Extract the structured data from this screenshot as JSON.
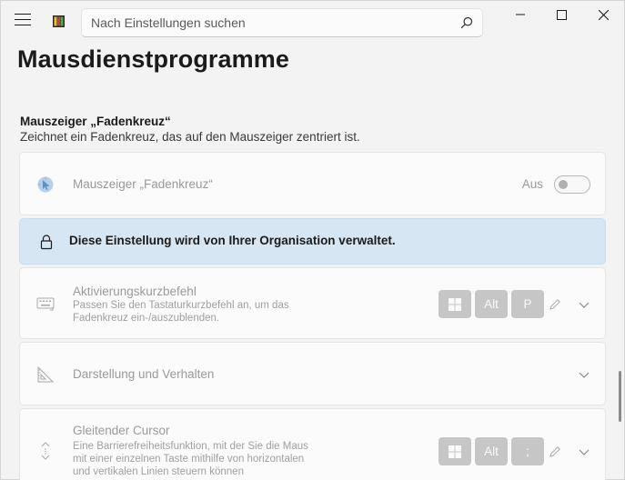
{
  "search": {
    "placeholder": "Nach Einstellungen suchen"
  },
  "page": {
    "title": "Mausdienstprogramme"
  },
  "section": {
    "title": "Mauszeiger „Fadenkreuz“",
    "description": "Zeichnet ein Fadenkreuz, das auf den Mauszeiger zentriert ist."
  },
  "crosshair_card": {
    "title": "Mauszeiger „Fadenkreuz“",
    "toggle_label": "Aus"
  },
  "policy_notice": {
    "text": "Diese Einstellung wird von Ihrer Organisation verwaltet."
  },
  "activation_card": {
    "title": "Aktivierungskurzbefehl",
    "subtitle_line1": "Passen Sie den Tastaturkurzbefehl an, um das",
    "subtitle_line2": "Fadenkreuz ein-/auszublenden.",
    "keys": [
      "Alt",
      "P"
    ]
  },
  "appearance_card": {
    "title": "Darstellung und Verhalten"
  },
  "gliding_card": {
    "title": "Gleitender Cursor",
    "subtitle_line1": "Eine Barrierefreiheitsfunktion, mit der Sie die Maus",
    "subtitle_line2": "mit einer einzelnen Taste mithilfe von horizontalen",
    "subtitle_line3": "und vertikalen Linien steuern können",
    "keys": [
      "Alt",
      ";"
    ]
  },
  "colors": {
    "accent_info": "#d6e6f3",
    "disabled_text": "#9a9a9a",
    "key_bg": "#c6c6c6"
  }
}
